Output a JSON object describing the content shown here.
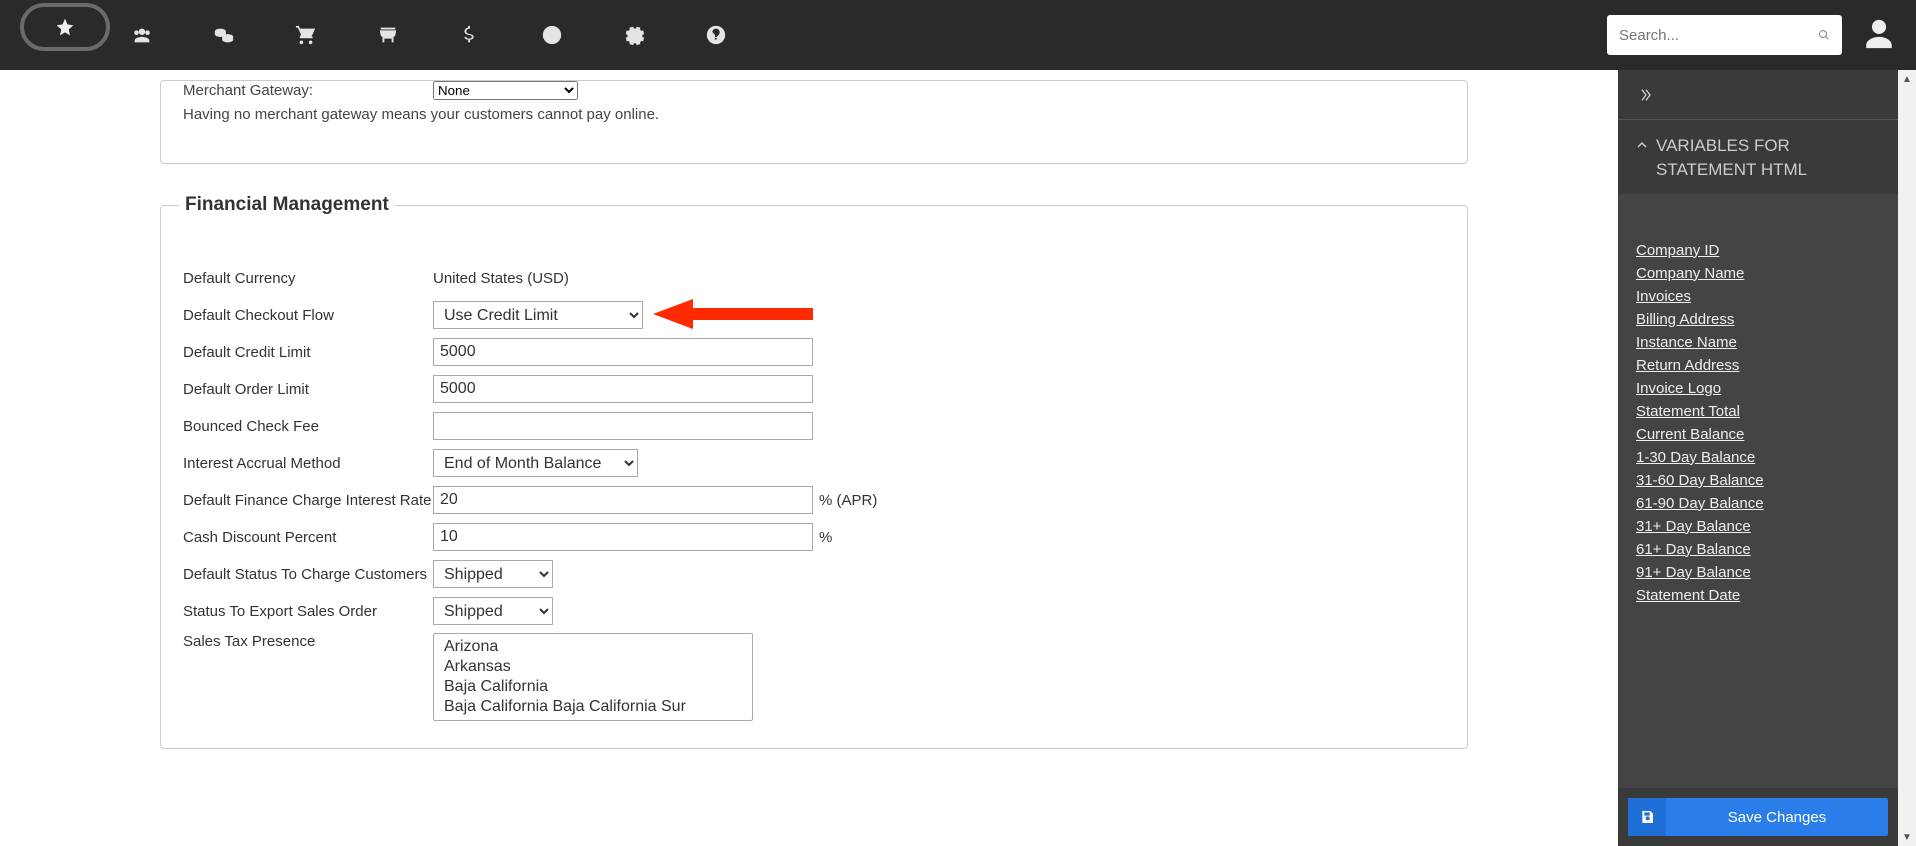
{
  "topbar": {
    "search_placeholder": "Search..."
  },
  "merchant": {
    "gateway_label": "Merchant Gateway:",
    "gateway_value": "None",
    "note": "Having no merchant gateway means your customers cannot pay online."
  },
  "financial": {
    "legend": "Financial Management",
    "default_currency_label": "Default Currency",
    "default_currency_value": "United States (USD)",
    "checkout_flow_label": "Default Checkout Flow",
    "checkout_flow_value": "Use Credit Limit",
    "credit_limit_label": "Default Credit Limit",
    "credit_limit_value": "5000",
    "order_limit_label": "Default Order Limit",
    "order_limit_value": "5000",
    "bounced_fee_label": "Bounced Check Fee",
    "bounced_fee_value": "",
    "interest_method_label": "Interest Accrual Method",
    "interest_method_value": "End of Month Balance",
    "finance_rate_label": "Default Finance Charge Interest Rate",
    "finance_rate_value": "20",
    "finance_rate_suffix": "% (APR)",
    "cash_discount_label": "Cash Discount Percent",
    "cash_discount_value": "10",
    "cash_discount_suffix": "%",
    "status_charge_label": "Default Status To Charge Customers",
    "status_charge_value": "Shipped",
    "status_export_label": "Status To Export Sales Order",
    "status_export_value": "Shipped",
    "sales_tax_label": "Sales Tax Presence",
    "sales_tax_options": [
      "Arizona",
      "Arkansas",
      "Baja California",
      "Baja California Baja California Sur"
    ]
  },
  "sidepanel": {
    "header": "VARIABLES FOR STATEMENT HTML",
    "links": [
      "Company ID",
      "Company Name",
      "Invoices",
      "Billing Address",
      "Instance Name",
      "Return Address",
      "Invoice Logo",
      "Statement Total",
      "Current Balance",
      "1-30 Day Balance",
      "31-60 Day Balance",
      "61-90 Day Balance",
      "31+ Day Balance",
      "61+ Day Balance",
      "91+ Day Balance",
      "Statement Date"
    ],
    "save_label": "Save Changes"
  }
}
